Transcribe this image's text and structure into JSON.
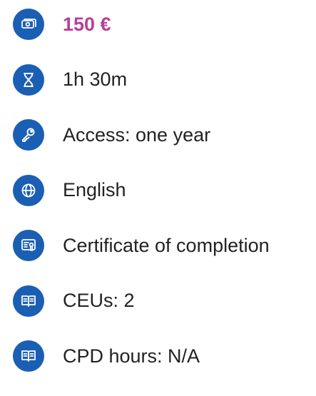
{
  "accent_color": "#1a5fb4",
  "price_color": "#b5409b",
  "items": [
    {
      "icon": "money-icon",
      "label": "150 €"
    },
    {
      "icon": "hourglass-icon",
      "label": "1h 30m"
    },
    {
      "icon": "key-icon",
      "label": "Access: one year"
    },
    {
      "icon": "globe-icon",
      "label": "English"
    },
    {
      "icon": "certificate-icon",
      "label": "Certificate of completion"
    },
    {
      "icon": "book-icon",
      "label": "CEUs: 2"
    },
    {
      "icon": "book-icon",
      "label": "CPD hours: N/A"
    }
  ]
}
